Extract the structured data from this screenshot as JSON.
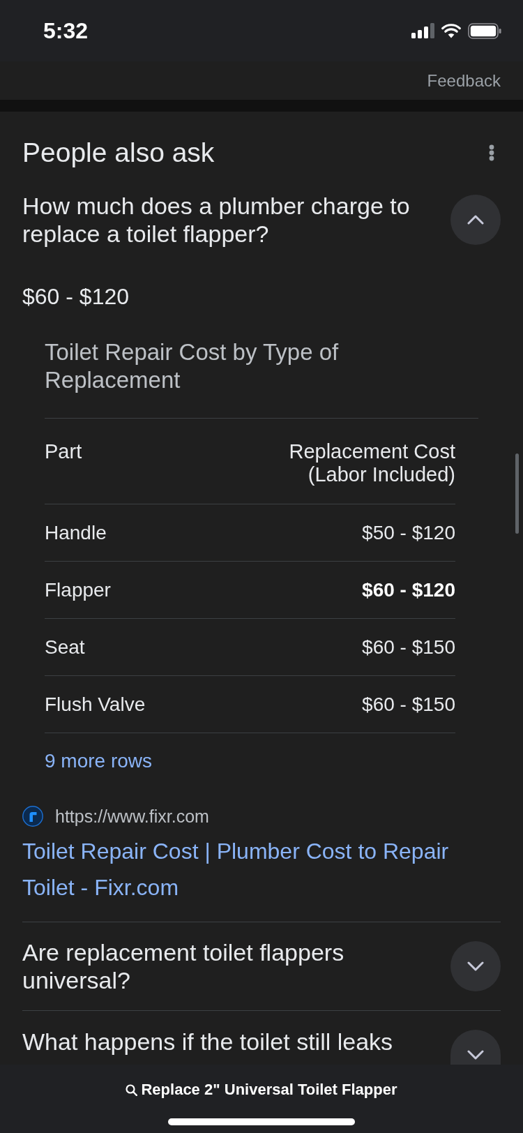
{
  "status_bar": {
    "time": "5:32"
  },
  "feedback": "Feedback",
  "section": {
    "title": "People also ask",
    "questions": [
      {
        "question": "How much does a plumber charge to replace a toilet flapper?",
        "expanded": true,
        "answer": {
          "summary": "$60 - $120",
          "table": {
            "title": "Toilet Repair Cost by Type of Replacement",
            "columns": [
              "Part",
              "Replacement Cost (Labor Included)"
            ],
            "rows": [
              {
                "cells": [
                  "Handle",
                  "$50 - $120"
                ],
                "highlighted": false
              },
              {
                "cells": [
                  "Flapper",
                  "$60 - $120"
                ],
                "highlighted": true
              },
              {
                "cells": [
                  "Seat",
                  "$60 - $150"
                ],
                "highlighted": false
              },
              {
                "cells": [
                  "Flush Valve",
                  "$60 - $150"
                ],
                "highlighted": false
              }
            ],
            "more_rows": "9 more rows"
          },
          "source": {
            "url": "https://www.fixr.com",
            "title": "Toilet Repair Cost | Plumber Cost to Repair Toilet - Fixr.com"
          }
        }
      },
      {
        "question": "Are replacement toilet flappers universal?",
        "expanded": false
      },
      {
        "question": "What happens if the toilet still leaks",
        "expanded": false
      }
    ]
  },
  "bottom_bar": {
    "search_query": "Replace 2\" Universal Toilet Flapper"
  }
}
